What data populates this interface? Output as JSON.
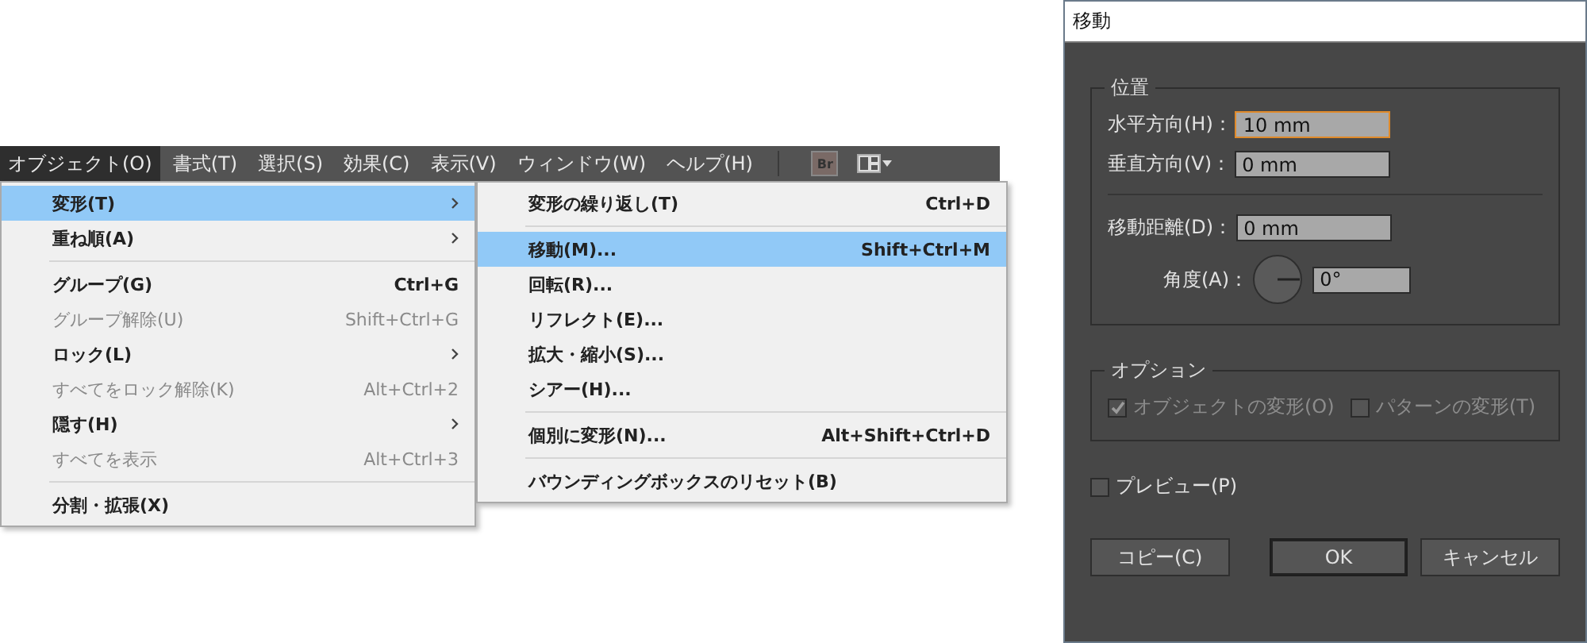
{
  "menubar": {
    "items": [
      {
        "label": "オブジェクト(O)",
        "selected": true
      },
      {
        "label": "書式(T)",
        "selected": false
      },
      {
        "label": "選択(S)",
        "selected": false
      },
      {
        "label": "効果(C)",
        "selected": false
      },
      {
        "label": "表示(V)",
        "selected": false
      },
      {
        "label": "ウィンドウ(W)",
        "selected": false
      },
      {
        "label": "ヘルプ(H)",
        "selected": false
      }
    ],
    "bridge_button": "Br"
  },
  "menu": {
    "items": [
      {
        "kind": "item",
        "label": "変形(T)",
        "selected": true,
        "disabled": false,
        "submenu": true
      },
      {
        "kind": "item",
        "label": "重ね順(A)",
        "selected": false,
        "disabled": false,
        "submenu": true
      },
      {
        "kind": "separator"
      },
      {
        "kind": "item",
        "label": "グループ(G)",
        "shortcut": "Ctrl+G",
        "selected": false,
        "disabled": false,
        "submenu": false
      },
      {
        "kind": "item",
        "label": "グループ解除(U)",
        "shortcut": "Shift+Ctrl+G",
        "selected": false,
        "disabled": true,
        "submenu": false
      },
      {
        "kind": "item",
        "label": "ロック(L)",
        "selected": false,
        "disabled": false,
        "submenu": true
      },
      {
        "kind": "item",
        "label": "すべてをロック解除(K)",
        "shortcut": "Alt+Ctrl+2",
        "selected": false,
        "disabled": true,
        "submenu": false
      },
      {
        "kind": "item",
        "label": "隠す(H)",
        "selected": false,
        "disabled": false,
        "submenu": true
      },
      {
        "kind": "item",
        "label": "すべてを表示",
        "shortcut": "Alt+Ctrl+3",
        "selected": false,
        "disabled": true,
        "submenu": false
      },
      {
        "kind": "separator"
      },
      {
        "kind": "item",
        "label": "分割・拡張(X)",
        "selected": false,
        "disabled": false,
        "submenu": false
      }
    ]
  },
  "submenu": {
    "items": [
      {
        "kind": "item",
        "label": "変形の繰り返し(T)",
        "shortcut": "Ctrl+D",
        "selected": false
      },
      {
        "kind": "separator"
      },
      {
        "kind": "item",
        "label": "移動(M)...",
        "shortcut": "Shift+Ctrl+M",
        "selected": true
      },
      {
        "kind": "item",
        "label": "回転(R)...",
        "selected": false
      },
      {
        "kind": "item",
        "label": "リフレクト(E)...",
        "selected": false
      },
      {
        "kind": "item",
        "label": "拡大・縮小(S)...",
        "selected": false
      },
      {
        "kind": "item",
        "label": "シアー(H)...",
        "selected": false
      },
      {
        "kind": "separator"
      },
      {
        "kind": "item",
        "label": "個別に変形(N)...",
        "shortcut": "Alt+Shift+Ctrl+D",
        "selected": false
      },
      {
        "kind": "separator"
      },
      {
        "kind": "item",
        "label": "バウンディングボックスのリセット(B)",
        "selected": false
      }
    ]
  },
  "dialog": {
    "title": "移動",
    "position": {
      "title": "位置",
      "rows": [
        {
          "kind": "field",
          "label": "水平方向(H)：",
          "value": "10 mm",
          "focused": true
        },
        {
          "kind": "field",
          "label": "垂直方向(V)：",
          "value": "0 mm",
          "focused": false
        },
        {
          "kind": "separator"
        },
        {
          "kind": "field",
          "label": "移動距離(D)：",
          "value": "0 mm",
          "focused": false
        },
        {
          "kind": "angle",
          "label": "角度(A)：",
          "value": "0°",
          "focused": false
        }
      ]
    },
    "options": {
      "title": "オプション",
      "checkboxes": [
        {
          "label": "オブジェクトの変形(O)",
          "checked": true,
          "disabled": true
        },
        {
          "label": "パターンの変形(T)",
          "checked": false,
          "disabled": true
        }
      ]
    },
    "preview": {
      "label": "プレビュー(P)",
      "checked": false
    },
    "buttons": [
      {
        "label": "コピー(C)",
        "default": false
      },
      {
        "label": "OK",
        "default": true
      },
      {
        "label": "キャンセル",
        "default": false
      }
    ]
  }
}
